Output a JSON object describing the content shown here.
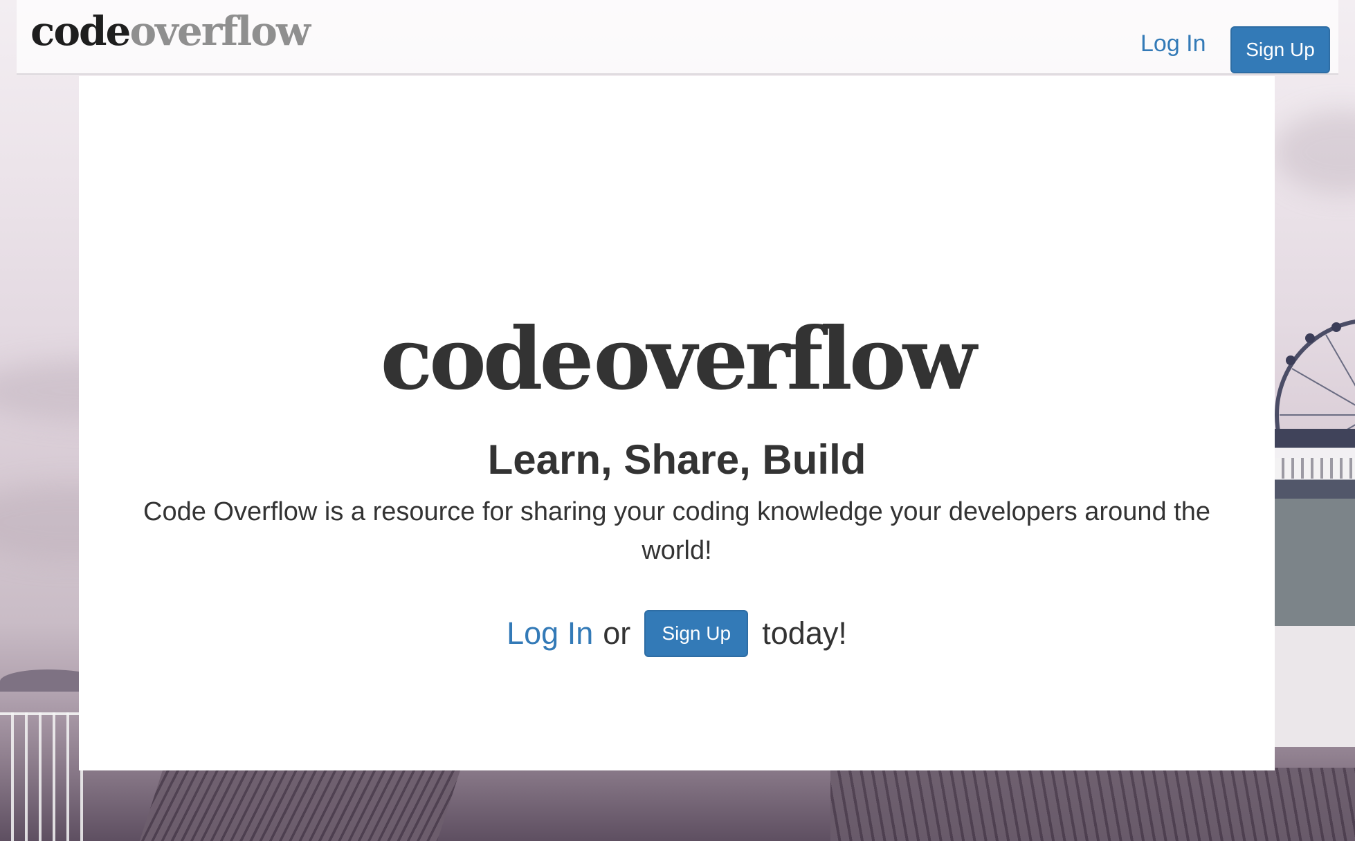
{
  "navbar": {
    "logo": {
      "part_a": "code",
      "part_b": "overflow"
    },
    "login_label": "Log In",
    "signup_label": "Sign Up"
  },
  "hero": {
    "logo": {
      "part_a": "code",
      "part_b": "overflow"
    },
    "tagline": "Learn, Share, Build",
    "description": "Code Overflow is a resource for sharing your coding knowledge your developers around the world!",
    "cta": {
      "login_label": "Log In",
      "or_text": "or",
      "signup_label": "Sign Up",
      "suffix_text": "today!"
    }
  },
  "colors": {
    "link": "#337ab7",
    "button_bg": "#337ab7",
    "text": "#333333",
    "logo_dark": "#1e1e1e",
    "logo_light": "#8f8f8f"
  }
}
